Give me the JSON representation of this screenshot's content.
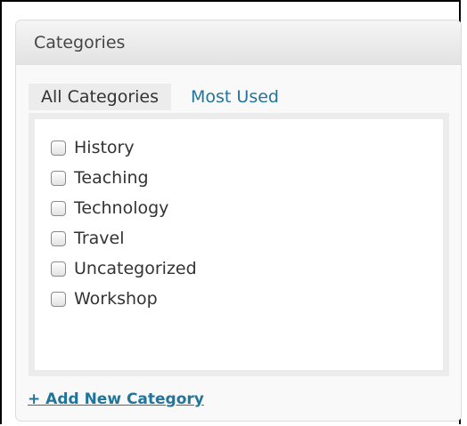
{
  "widget": {
    "title": "Categories",
    "tabs": [
      {
        "label": "All Categories",
        "active": true
      },
      {
        "label": "Most Used",
        "active": false
      }
    ],
    "categories": [
      {
        "label": "History",
        "checked": false
      },
      {
        "label": "Teaching",
        "checked": false
      },
      {
        "label": "Technology",
        "checked": false
      },
      {
        "label": "Travel",
        "checked": false
      },
      {
        "label": "Uncategorized",
        "checked": false
      },
      {
        "label": "Workshop",
        "checked": false
      }
    ],
    "add_new_label": "+ Add New Category"
  },
  "colors": {
    "link": "#21759b",
    "text": "#333333",
    "header_bg": "#e9e9e9"
  }
}
